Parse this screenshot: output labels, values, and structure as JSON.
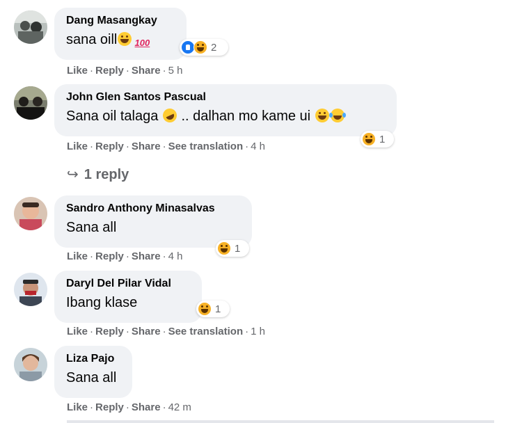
{
  "comments": [
    {
      "name": "Dang Masangkay",
      "text": "sana oill",
      "emojis": [
        "grin",
        "100"
      ],
      "reactions": [
        "like",
        "haha"
      ],
      "reaction_count": "2",
      "actions": {
        "like": "Like",
        "reply": "Reply",
        "share": "Share",
        "time": "5 h"
      }
    },
    {
      "name": "John Glen Santos Pascual",
      "text": "Sana oil talaga",
      "text2": ".. dalhan mo kame ui",
      "emojis": [
        "rofl",
        "grin",
        "tears"
      ],
      "reactions": [
        "haha"
      ],
      "reaction_count": "1",
      "actions": {
        "like": "Like",
        "reply": "Reply",
        "share": "Share",
        "translate": "See translation",
        "time": "4 h"
      },
      "replies_label": "1 reply"
    },
    {
      "name": "Sandro Anthony Minasalvas",
      "text": "Sana all",
      "reactions": [
        "haha"
      ],
      "reaction_count": "1",
      "actions": {
        "like": "Like",
        "reply": "Reply",
        "share": "Share",
        "time": "4 h"
      }
    },
    {
      "name": "Daryl Del Pilar Vidal",
      "text": "Ibang klase",
      "reactions": [
        "haha"
      ],
      "reaction_count": "1",
      "actions": {
        "like": "Like",
        "reply": "Reply",
        "share": "Share",
        "translate": "See translation",
        "time": "1 h"
      }
    },
    {
      "name": "Liza Pajo",
      "text": "Sana all",
      "actions": {
        "like": "Like",
        "reply": "Reply",
        "share": "Share",
        "time": "42 m"
      }
    }
  ],
  "separator": "·",
  "colors": {
    "bubble": "#f0f2f5",
    "meta": "#65676b",
    "like_blue": "#1877f2",
    "haha_yellow": "#f7b125"
  }
}
